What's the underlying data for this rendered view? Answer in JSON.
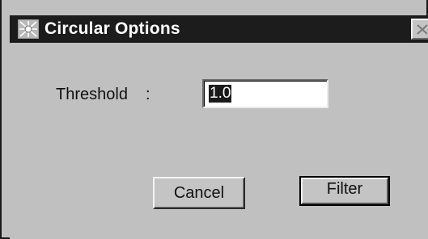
{
  "window": {
    "title": "Circular Options",
    "icons": {
      "app": "app-icon",
      "close": "close-icon"
    }
  },
  "form": {
    "threshold_label": "Threshold",
    "threshold_separator": ":",
    "threshold_value": "1.0"
  },
  "buttons": {
    "cancel_label": "Cancel",
    "filter_label": "Filter"
  },
  "colors": {
    "titlebar": "#1c1c1c",
    "dialog_bg": "#c0c0c0",
    "selection": "#1a1a1a"
  }
}
